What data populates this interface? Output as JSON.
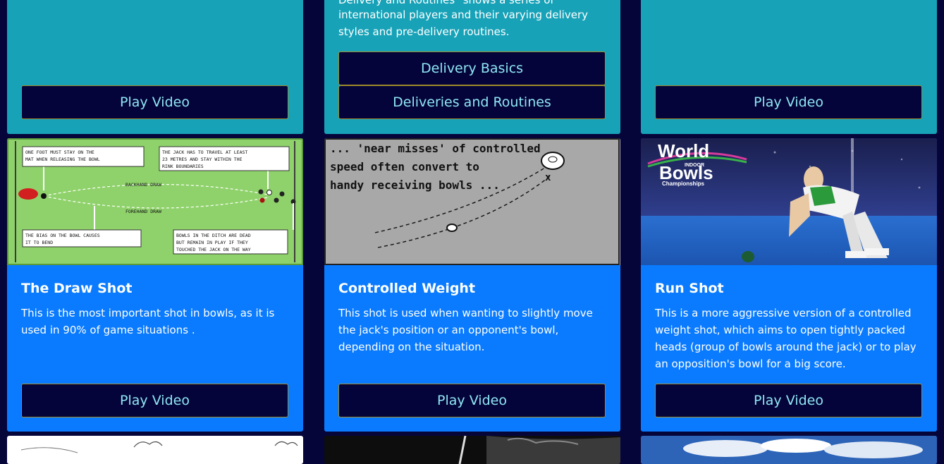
{
  "top_row": {
    "left": {
      "button": "Play Video"
    },
    "middle": {
      "description_line1": "Delivery and Routines\" shows a series of",
      "description_line2": "international players and their varying delivery",
      "description_line3": "styles and pre-delivery routines.",
      "button1": "Delivery Basics",
      "button2": "Deliveries and Routines"
    },
    "right": {
      "button": "Play Video"
    }
  },
  "middle_row": {
    "draw_shot": {
      "title": "The Draw Shot",
      "description": "This is the most important shot in bowls, as it is used in 90% of game situations .",
      "button": "Play Video",
      "diagram": {
        "note1a": "ONE FOOT MUST STAY ON THE",
        "note1b": "MAT WHEN RELEASING THE BOWL",
        "note2a": "THE JACK HAS TO TRAVEL AT LEAST",
        "note2b": "23 METRES AND STAY WITHIN THE",
        "note2c": "RINK BOUNDARIES",
        "backhand": "BACKHAND DRAW",
        "forehand": "FOREHAND DRAW",
        "note3a": "THE BIAS ON THE BOWL CAUSES",
        "note3b": "IT TO BEND",
        "note4a": "BOWLS IN THE DITCH ARE DEAD",
        "note4b": "BUT REMAIN IN PLAY IF THEY",
        "note4c": "TOUCHED THE JACK ON THE WAY"
      }
    },
    "controlled_weight": {
      "title": "Controlled Weight",
      "description": "This shot is used when wanting to slightly move the jack's position or an opponent's bowl, depending on the situation.",
      "button": "Play Video",
      "diagram": {
        "line1": "... 'near misses' of controlled",
        "line2": "speed often convert to",
        "line3": "handy receiving bowls ..."
      }
    },
    "run_shot": {
      "title": "Run Shot",
      "description": "This is a more aggressive version of a controlled weight shot, which aims to open tightly packed heads (group of bowls around the jack) or to play an opposition's bowl for a big score.",
      "button": "Play Video",
      "photo": {
        "logo_line1": "World",
        "logo_line2": "INDOOR",
        "logo_line3": "Bowls",
        "logo_line4": "Championships"
      }
    }
  },
  "colors": {
    "page_bg": "#06053a",
    "teal_card": "#17a2b8",
    "blue_card": "#0a7bff",
    "button_bg": "#04043a",
    "button_text": "#8fe6f3",
    "button_border": "#a08b2a"
  }
}
